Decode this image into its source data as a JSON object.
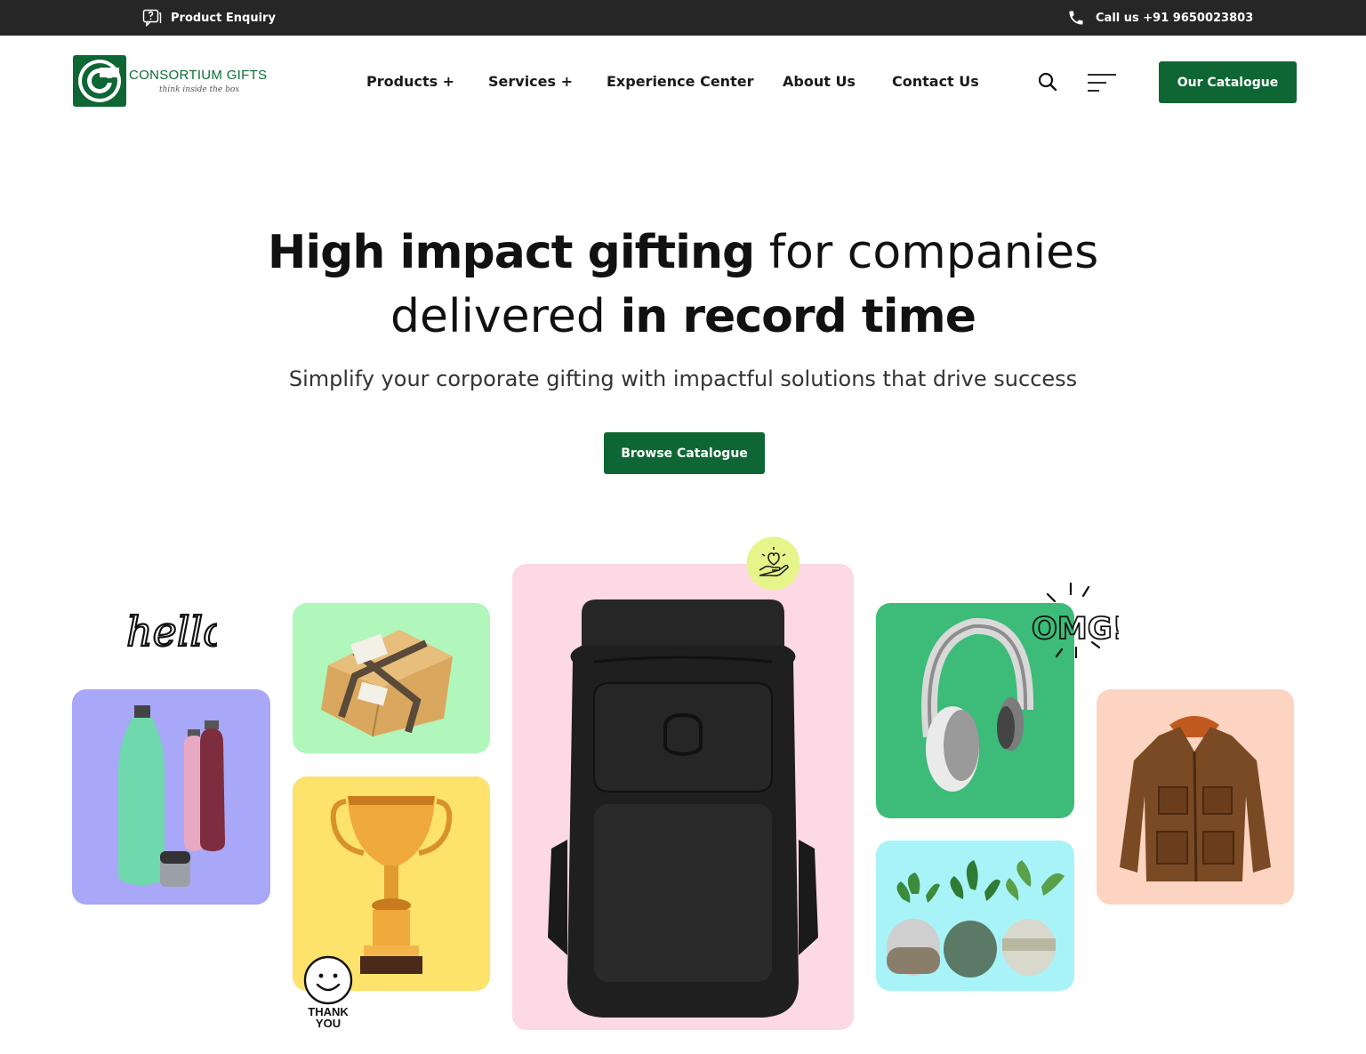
{
  "topbar": {
    "enquiry_label": "Product Enquiry",
    "enquiry_icon": "chat-question-icon",
    "call_label": "Call us +91 9650023803",
    "call_icon": "phone-icon"
  },
  "brand": {
    "name": "CONSORTIUM GIFTS",
    "tagline": "think inside the box",
    "color": "#0d6633"
  },
  "nav": {
    "items": [
      {
        "label": "Products +"
      },
      {
        "label": "Services +"
      },
      {
        "label": "Experience Center"
      },
      {
        "label": "About Us"
      },
      {
        "label": "Contact Us"
      }
    ],
    "search_icon": "search-icon",
    "menu_icon": "hamburger-menu-icon",
    "cta_label": "Our Catalogue"
  },
  "hero": {
    "title_bold_1": "High impact gifting",
    "title_light_1": " for companies",
    "title_light_2": "delivered ",
    "title_bold_2": "in record time",
    "subtitle": "Simplify your corporate gifting with impactful solutions that drive success",
    "cta_label": "Browse Catalogue"
  },
  "gallery": {
    "stickers": {
      "hello": "hello",
      "omg": "OMG!!",
      "thank_you_line1": "THANK",
      "thank_you_line2": "YOU"
    },
    "cards": [
      {
        "item": "water bottles",
        "bg": "#a9a7f7"
      },
      {
        "item": "gift box",
        "bg": "#b1f7bb"
      },
      {
        "item": "trophy",
        "bg": "#fde26c"
      },
      {
        "item": "backpack",
        "bg": "#fdd8e5"
      },
      {
        "item": "headphones",
        "bg": "#3dbb78"
      },
      {
        "item": "plant pots",
        "bg": "#a8f3f8"
      },
      {
        "item": "jacket",
        "bg": "#fdd3c2"
      }
    ]
  }
}
